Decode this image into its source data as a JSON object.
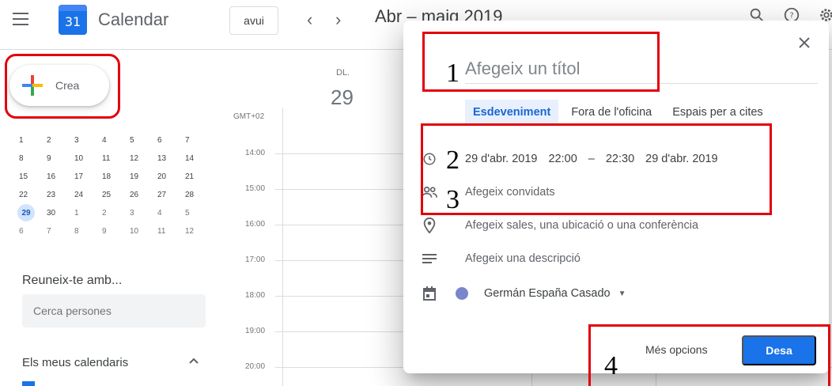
{
  "header": {
    "app_icon_day": "31",
    "app_title": "Calendar",
    "today_button": "avui",
    "prev_arrow": "‹",
    "next_arrow": "›",
    "period": "Abr – maig 2019"
  },
  "sidebar": {
    "create_label": "Crea",
    "mini_calendar": [
      [
        "1",
        "2",
        "3",
        "4",
        "5",
        "6",
        "7"
      ],
      [
        "8",
        "9",
        "10",
        "11",
        "12",
        "13",
        "14"
      ],
      [
        "15",
        "16",
        "17",
        "18",
        "19",
        "20",
        "21"
      ],
      [
        "22",
        "23",
        "24",
        "25",
        "26",
        "27",
        "28"
      ],
      [
        "29",
        "30",
        "1",
        "2",
        "3",
        "4",
        "5"
      ],
      [
        "6",
        "7",
        "8",
        "9",
        "10",
        "11",
        "12"
      ]
    ],
    "selected_day": "29",
    "meet_with_title": "Reuneix-te amb...",
    "search_people_placeholder": "Cerca persones",
    "my_calendars_label": "Els meus calendaris"
  },
  "grid": {
    "day_name": "DL.",
    "day_number": "29",
    "timezone": "GMT+02",
    "times": [
      "14:00",
      "15:00",
      "16:00",
      "17:00",
      "18:00",
      "19:00",
      "20:00"
    ]
  },
  "dialog": {
    "title_placeholder": "Afegeix un títol",
    "tabs": [
      "Esdeveniment",
      "Fora de l'oficina",
      "Espais per a cites"
    ],
    "start_date": "29 d'abr. 2019",
    "start_time": "22:00",
    "dash": "–",
    "end_time": "22:30",
    "end_date": "29 d'abr. 2019",
    "guests": "Afegeix convidats",
    "location": "Afegeix sales, una ubicació o una conferència",
    "description": "Afegeix una descripció",
    "calendar_owner": "Germán España Casado",
    "calendar_color": "#7986cb",
    "more_options": "Més opcions",
    "save": "Desa"
  },
  "annotations": [
    "1",
    "2",
    "3",
    "4"
  ],
  "accent_color": "#1a73e8",
  "annotation_color": "#e3000b"
}
